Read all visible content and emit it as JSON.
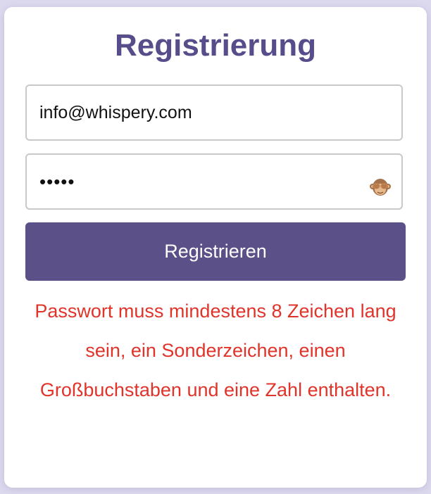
{
  "form": {
    "title": "Registrierung",
    "email": {
      "value": "info@whispery.com"
    },
    "password": {
      "value": "•••••",
      "toggle_icon": "see-no-evil-monkey-icon"
    },
    "submit_label": "Registrieren",
    "error_message": "Passwort muss mindestens 8 Zeichen lang sein, ein Sonderzeichen, einen Großbuchstaben und eine Zahl enthalten."
  },
  "colors": {
    "page_background": "#dcd9ee",
    "card_background": "#ffffff",
    "title": "#574d8b",
    "button": "#5b5088",
    "button_text": "#ffffff",
    "error": "#e0342a",
    "input_border": "#c9c9cc"
  }
}
